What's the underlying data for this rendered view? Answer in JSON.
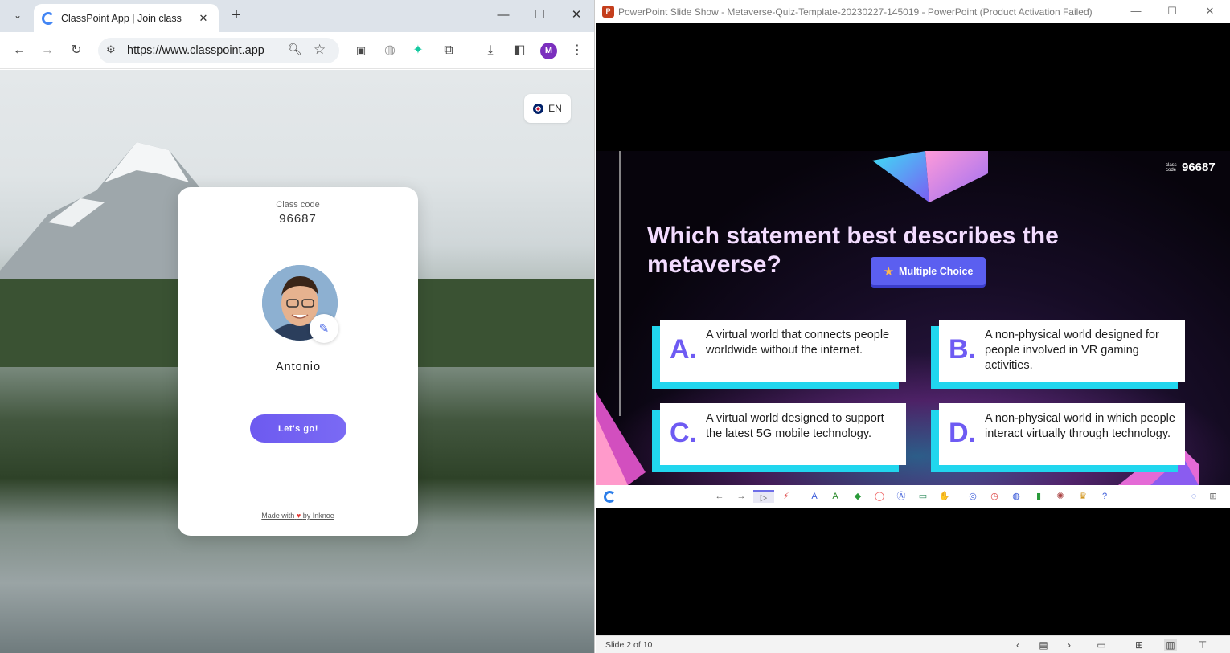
{
  "browser": {
    "tab_title": "ClassPoint App | Join class",
    "tab_close": "✕",
    "new_tab": "+",
    "window_controls": [
      "—",
      "☐",
      "✕"
    ],
    "url": "https://www.classpoint.app",
    "avatar_letter": "M",
    "icons": [
      "tab-search-icon",
      "back-icon",
      "forward-icon",
      "reload-icon",
      "site-info-icon",
      "zoom-icon",
      "star-icon",
      "picture-in-picture-icon",
      "globe-icon",
      "extension-pin-icon",
      "extensions-icon",
      "download-icon",
      "side-panel-icon",
      "kebab-menu-icon"
    ]
  },
  "classpoint": {
    "language": "EN",
    "class_code_label": "Class code",
    "class_code": "96687",
    "name_value": "Antonio",
    "go_label": "Let's go!",
    "footer_prefix": "Made with",
    "footer_heart": "♥",
    "footer_suffix": "by Inknoe"
  },
  "powerpoint": {
    "title": "PowerPoint Slide Show  -  Metaverse-Quiz-Template-20230227-145019 - PowerPoint (Product Activation Failed)",
    "logo_letter": "P",
    "window_controls": [
      "—",
      "☐",
      "✕"
    ],
    "slide": {
      "class_code_small": "class code",
      "class_code": "96687",
      "question": "Which statement best describes the metaverse?",
      "badge": "Multiple Choice",
      "answers": [
        {
          "letter": "A.",
          "text": "A virtual world that connects people worldwide without the internet."
        },
        {
          "letter": "B.",
          "text": "A non-physical world designed for people involved in VR gaming activities."
        },
        {
          "letter": "C.",
          "text": "A virtual world designed to support the latest 5G mobile technology."
        },
        {
          "letter": "D.",
          "text": "A non-physical world in which people interact virtually through technology."
        }
      ]
    },
    "status": {
      "slide_count": "Slide 2 of 10"
    }
  },
  "colors": {
    "accent_purple": "#6e5bf3",
    "answer_shadow_cyan": "#21d6ee",
    "question_text": "#f3dcff",
    "go_button": "#6d5af0"
  }
}
